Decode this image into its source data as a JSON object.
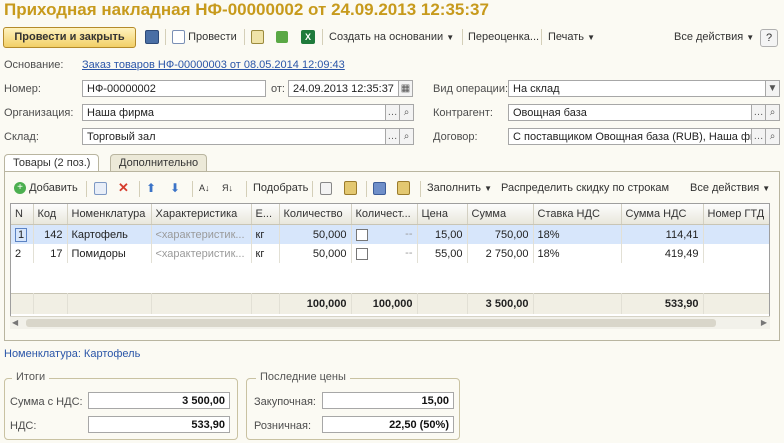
{
  "window": {
    "title": "Приходная накладная НФ-00000002 от 24.09.2013 12:35:37"
  },
  "toolbar": {
    "post_close": "Провести и закрыть",
    "post": "Провести",
    "create_based": "Создать на основании",
    "reprice": "Переоценка...",
    "print": "Печать",
    "all_actions": "Все действия",
    "help": "?"
  },
  "form": {
    "basis_label": "Основание:",
    "basis_link": "Заказ товаров НФ-00000003 от 08.05.2014 12:09:43",
    "number_label": "Номер:",
    "number_value": "НФ-00000002",
    "date_label": "от:",
    "date_value": "24.09.2013 12:35:37",
    "operation_label": "Вид операции:",
    "operation_value": "На склад",
    "org_label": "Организация:",
    "org_value": "Наша фирма",
    "counterparty_label": "Контрагент:",
    "counterparty_value": "Овощная база",
    "warehouse_label": "Склад:",
    "warehouse_value": "Торговый зал",
    "contract_label": "Договор:",
    "contract_value": "С поставщиком Овощная база (RUB), Наша фи"
  },
  "tabs": [
    {
      "label": "Товары (2 поз.)"
    },
    {
      "label": "Дополнительно"
    }
  ],
  "grid_toolbar": {
    "add": "Добавить",
    "select": "Подобрать",
    "fill": "Заполнить",
    "distribute": "Распределить скидку по строкам",
    "all_actions": "Все действия"
  },
  "table": {
    "columns": [
      "N",
      "Код",
      "Номенклатура",
      "Характеристика",
      "Е...",
      "Количество",
      "Количест...",
      "Цена",
      "Сумма",
      "Ставка НДС",
      "Сумма НДС",
      "Номер ГТД"
    ],
    "rows": [
      {
        "n": "1",
        "code": "142",
        "item": "Картофель",
        "char": "<характеристик...",
        "unit": "кг",
        "qty": "50,000",
        "qty2": "--",
        "price": "15,00",
        "sum": "750,00",
        "vat_rate": "18%",
        "vat_sum": "114,41",
        "gtd": ""
      },
      {
        "n": "2",
        "code": "17",
        "item": "Помидоры",
        "char": "<характеристик...",
        "unit": "кг",
        "qty": "50,000",
        "qty2": "--",
        "price": "55,00",
        "sum": "2 750,00",
        "vat_rate": "18%",
        "vat_sum": "419,49",
        "gtd": ""
      }
    ],
    "totals": {
      "qty": "100,000",
      "qty2": "100,000",
      "sum": "3 500,00",
      "vat_sum": "533,90"
    }
  },
  "nomenclature_link": "Номенклатура: Картофель",
  "totals_group": {
    "title": "Итоги",
    "sum_label": "Сумма с НДС:",
    "sum_value": "3 500,00",
    "vat_label": "НДС:",
    "vat_value": "533,90"
  },
  "prices_group": {
    "title": "Последние цены",
    "purchase_label": "Закупочная:",
    "purchase_value": "15,00",
    "retail_label": "Розничная:",
    "retail_value": "22,50 (50%)"
  },
  "colors": {
    "title": "#c79a1c",
    "link": "#2a55a8",
    "selected_row": "#d7e6fb",
    "accent_button": "#f2cf67"
  },
  "icons": [
    "save-icon",
    "post-icon",
    "journal-icon",
    "download-icon",
    "excel-icon",
    "add-icon",
    "copy-icon",
    "delete-icon",
    "up-icon",
    "down-icon",
    "sort-asc-icon",
    "sort-desc-icon",
    "select-icon",
    "paste-icon",
    "dropdown-icon",
    "search-icon"
  ]
}
